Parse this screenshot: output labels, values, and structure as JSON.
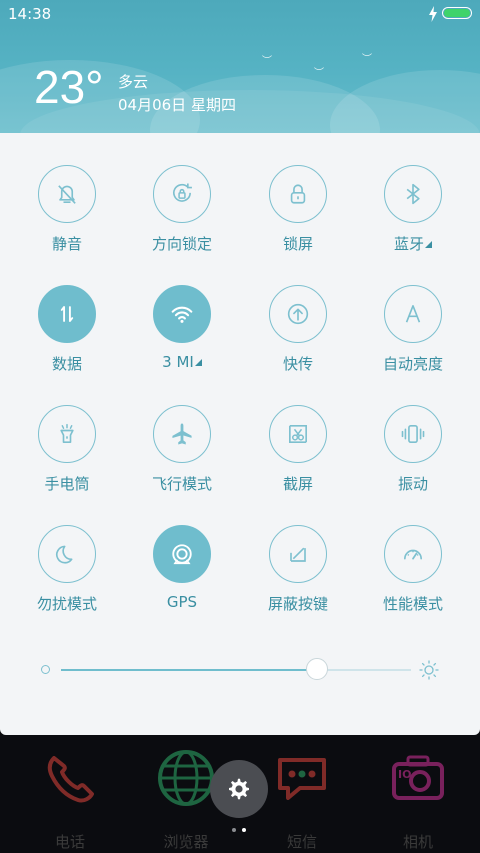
{
  "status_bar": {
    "time": "14:38",
    "battery_color": "#3fd36b"
  },
  "weather": {
    "temperature": "23°",
    "condition": "多云",
    "date": "04月06日 星期四"
  },
  "toggles": [
    {
      "label": "静音",
      "icon": "bell-off-icon",
      "on": false,
      "caret": false
    },
    {
      "label": "方向锁定",
      "icon": "rotation-lock-icon",
      "on": false,
      "caret": false
    },
    {
      "label": "锁屏",
      "icon": "lock-icon",
      "on": false,
      "caret": false
    },
    {
      "label": "蓝牙",
      "icon": "bluetooth-icon",
      "on": false,
      "caret": true
    },
    {
      "label": "数据",
      "icon": "mobile-data-icon",
      "on": true,
      "caret": false
    },
    {
      "label": "3 MI",
      "icon": "wifi-icon",
      "on": true,
      "caret": true
    },
    {
      "label": "快传",
      "icon": "quick-transfer-icon",
      "on": false,
      "caret": false
    },
    {
      "label": "自动亮度",
      "icon": "auto-brightness-icon",
      "on": false,
      "caret": false
    },
    {
      "label": "手电筒",
      "icon": "flashlight-icon",
      "on": false,
      "caret": false
    },
    {
      "label": "飞行模式",
      "icon": "airplane-icon",
      "on": false,
      "caret": false
    },
    {
      "label": "截屏",
      "icon": "screenshot-icon",
      "on": false,
      "caret": false
    },
    {
      "label": "振动",
      "icon": "vibrate-icon",
      "on": false,
      "caret": false
    },
    {
      "label": "勿扰模式",
      "icon": "moon-icon",
      "on": false,
      "caret": false
    },
    {
      "label": "GPS",
      "icon": "gps-icon",
      "on": true,
      "caret": false
    },
    {
      "label": "屏蔽按键",
      "icon": "block-keys-icon",
      "on": false,
      "caret": false
    },
    {
      "label": "性能模式",
      "icon": "speedometer-icon",
      "on": false,
      "caret": false
    }
  ],
  "brightness": {
    "level": 0.73
  },
  "dock": {
    "apps": [
      {
        "label": "电话",
        "icon": "phone-icon",
        "color": "#e0453c"
      },
      {
        "label": "浏览器",
        "icon": "browser-icon",
        "color": "#2fae6a"
      },
      {
        "label": "短信",
        "icon": "message-icon",
        "color": "#e0453c"
      },
      {
        "label": "相机",
        "icon": "camera-icon",
        "color": "#d4339a"
      }
    ]
  },
  "pager": {
    "current": 1,
    "count": 2
  },
  "colors": {
    "accent": "#6fbdcd",
    "label": "#3a8fa2",
    "panel": "#f3f5f7",
    "header": "#56b3c4"
  }
}
